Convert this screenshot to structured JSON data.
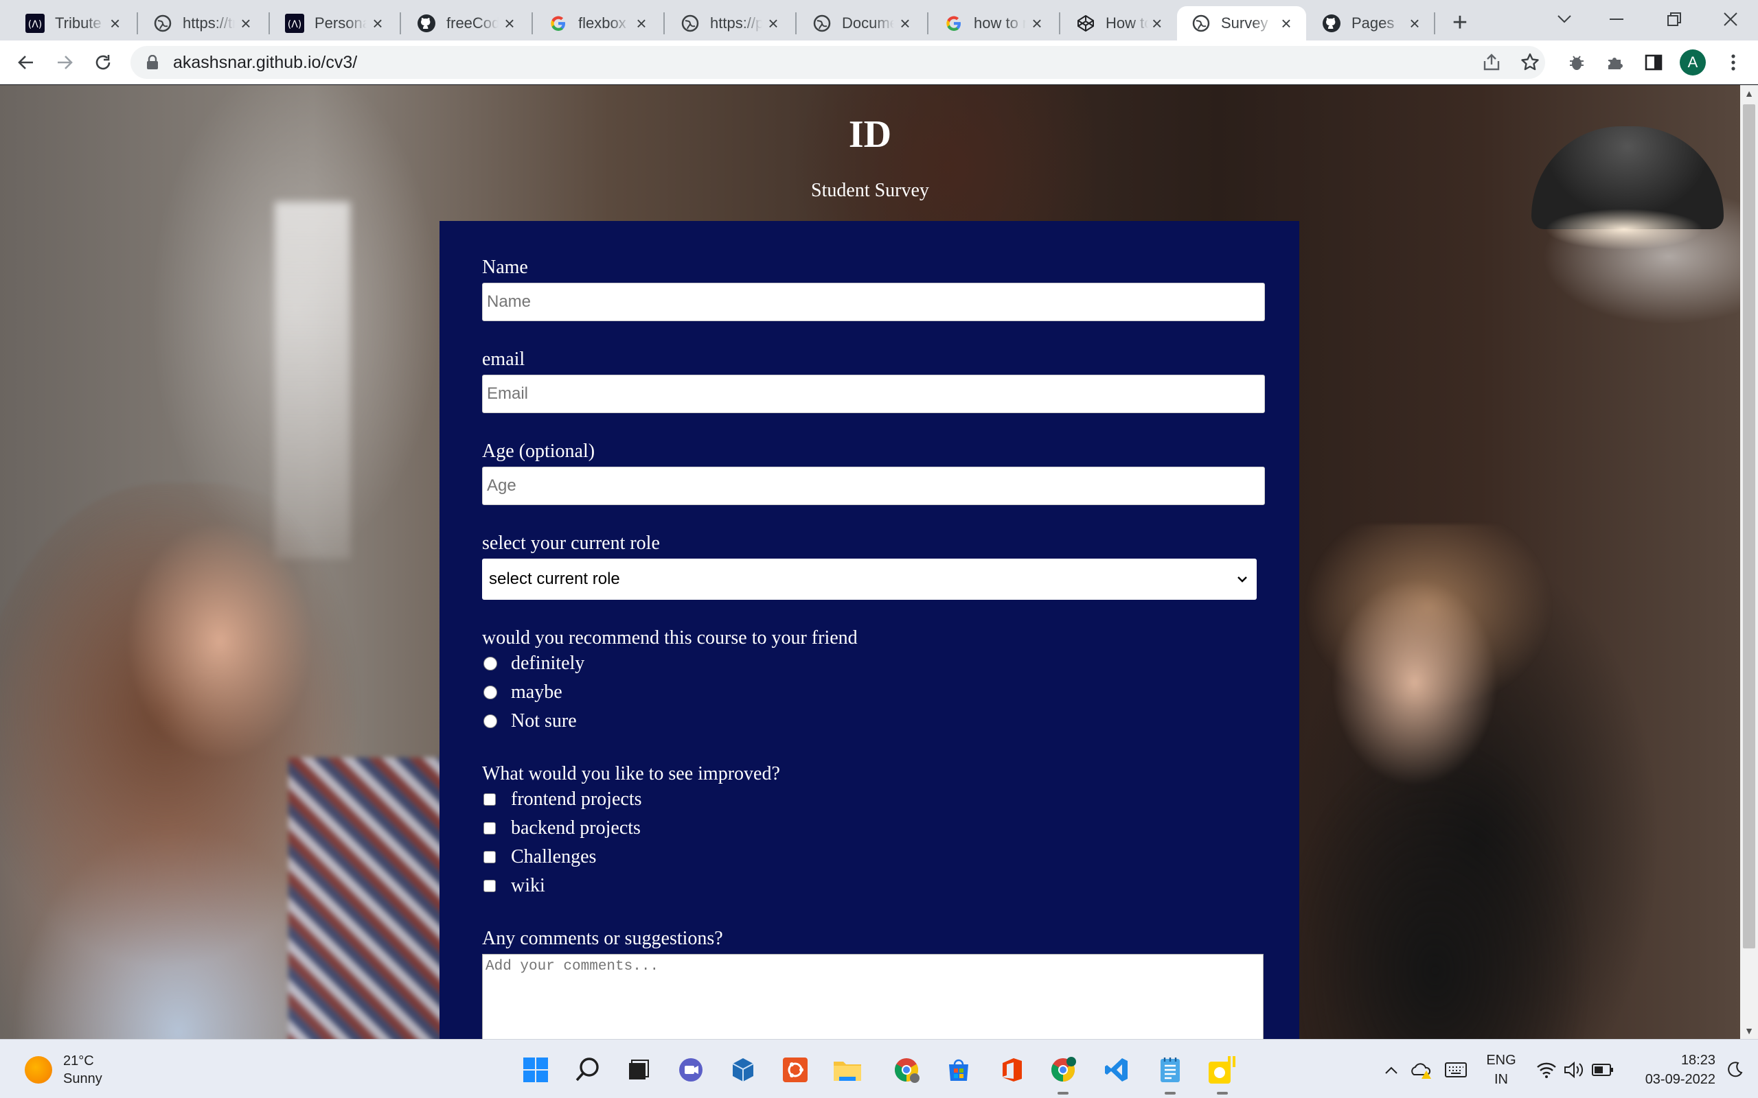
{
  "browser": {
    "tabs": [
      {
        "title": "Tribute Page",
        "icon": "fcc-icon"
      },
      {
        "title": "https://tributepage",
        "icon": "globe-icon"
      },
      {
        "title": "Personal Portfolio",
        "icon": "fcc-icon"
      },
      {
        "title": "freeCodeCamp",
        "icon": "github-icon"
      },
      {
        "title": "flexbox - Google",
        "icon": "google-icon"
      },
      {
        "title": "https://page",
        "icon": "globe-icon"
      },
      {
        "title": "Document",
        "icon": "globe-icon"
      },
      {
        "title": "how to make",
        "icon": "google-icon"
      },
      {
        "title": "How to",
        "icon": "codepen-icon"
      },
      {
        "title": "Survey Form",
        "icon": "globe-icon",
        "active": true
      },
      {
        "title": "Pages",
        "icon": "github-icon"
      }
    ],
    "url": "akashsnar.github.io/cv3/",
    "profile_initial": "A"
  },
  "page": {
    "title": "ID",
    "description": "Student Survey"
  },
  "form": {
    "name": {
      "label": "Name",
      "placeholder": "Name"
    },
    "email": {
      "label": "email",
      "placeholder": "Email"
    },
    "age": {
      "label": "Age (optional)",
      "placeholder": "Age"
    },
    "role": {
      "label": "select your current role",
      "selected": "select current role"
    },
    "recommend": {
      "label": "would you recommend this course to your friend",
      "options": [
        "definitely",
        "maybe",
        "Not sure"
      ]
    },
    "improve": {
      "label": "What would you like to see improved?",
      "options": [
        "frontend projects",
        "backend projects",
        "Challenges",
        "wiki"
      ]
    },
    "comments": {
      "label": "Any comments or suggestions?",
      "placeholder": "Add your comments..."
    }
  },
  "taskbar": {
    "weather_temp": "21°C",
    "weather_desc": "Sunny",
    "lang_top": "ENG",
    "lang_bottom": "IN",
    "time": "18:23",
    "date": "03-09-2022"
  }
}
